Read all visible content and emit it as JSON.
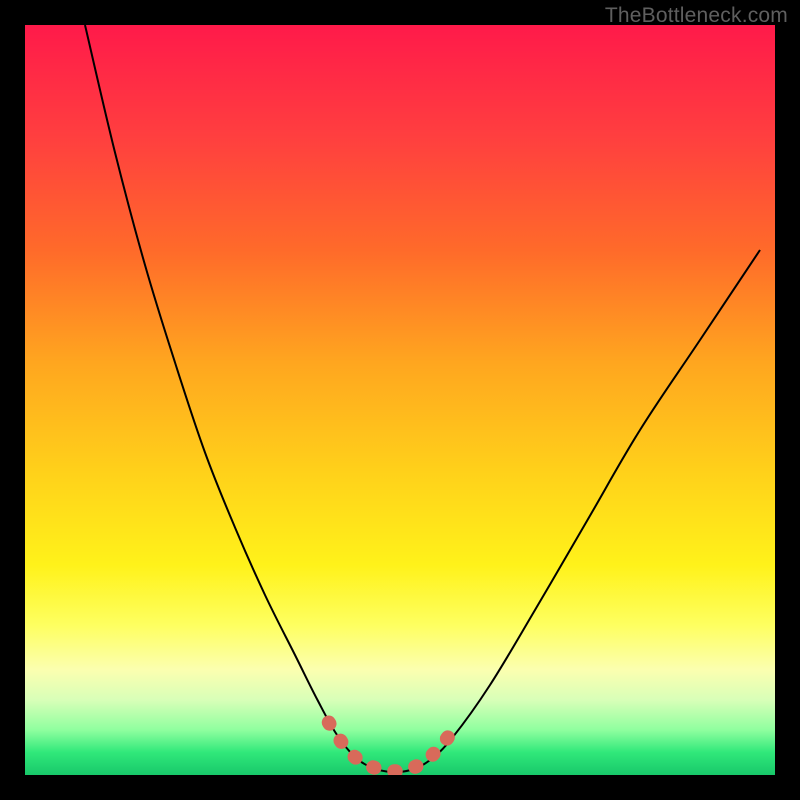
{
  "watermark": "TheBottleneck.com",
  "chart_data": {
    "type": "line",
    "title": "",
    "xlabel": "",
    "ylabel": "",
    "xlim": [
      0,
      100
    ],
    "ylim": [
      0,
      100
    ],
    "background": {
      "type": "vertical-gradient",
      "stops": [
        {
          "offset": 0.0,
          "color": "#ff1a4a"
        },
        {
          "offset": 0.15,
          "color": "#ff3f3f"
        },
        {
          "offset": 0.3,
          "color": "#ff6a2a"
        },
        {
          "offset": 0.45,
          "color": "#ffa61f"
        },
        {
          "offset": 0.6,
          "color": "#ffd21a"
        },
        {
          "offset": 0.72,
          "color": "#fff21a"
        },
        {
          "offset": 0.8,
          "color": "#feff60"
        },
        {
          "offset": 0.86,
          "color": "#fbffb0"
        },
        {
          "offset": 0.9,
          "color": "#d8ffb8"
        },
        {
          "offset": 0.94,
          "color": "#8fff9f"
        },
        {
          "offset": 0.97,
          "color": "#30e87a"
        },
        {
          "offset": 1.0,
          "color": "#18c86a"
        }
      ]
    },
    "series": [
      {
        "name": "bottleneck-curve",
        "stroke": "#000000",
        "stroke_width": 2,
        "points": [
          {
            "x": 8.0,
            "y": 100.0
          },
          {
            "x": 12.0,
            "y": 83.0
          },
          {
            "x": 16.0,
            "y": 68.0
          },
          {
            "x": 20.0,
            "y": 55.0
          },
          {
            "x": 24.0,
            "y": 43.0
          },
          {
            "x": 28.0,
            "y": 33.0
          },
          {
            "x": 32.0,
            "y": 24.0
          },
          {
            "x": 36.0,
            "y": 16.0
          },
          {
            "x": 39.0,
            "y": 10.0
          },
          {
            "x": 41.5,
            "y": 5.5
          },
          {
            "x": 44.0,
            "y": 2.4
          },
          {
            "x": 46.5,
            "y": 0.9
          },
          {
            "x": 49.0,
            "y": 0.4
          },
          {
            "x": 51.5,
            "y": 0.7
          },
          {
            "x": 54.0,
            "y": 2.0
          },
          {
            "x": 57.0,
            "y": 5.0
          },
          {
            "x": 62.0,
            "y": 12.0
          },
          {
            "x": 68.0,
            "y": 22.0
          },
          {
            "x": 75.0,
            "y": 34.0
          },
          {
            "x": 82.0,
            "y": 46.0
          },
          {
            "x": 90.0,
            "y": 58.0
          },
          {
            "x": 98.0,
            "y": 70.0
          }
        ]
      },
      {
        "name": "optimal-segment",
        "stroke": "#d86a5a",
        "stroke_width": 14,
        "stroke_dasharray": "1.5 20",
        "linecap": "round",
        "points": [
          {
            "x": 40.5,
            "y": 7.0
          },
          {
            "x": 42.5,
            "y": 4.0
          },
          {
            "x": 44.5,
            "y": 2.0
          },
          {
            "x": 46.8,
            "y": 0.9
          },
          {
            "x": 49.0,
            "y": 0.5
          },
          {
            "x": 51.2,
            "y": 0.8
          },
          {
            "x": 53.3,
            "y": 1.8
          },
          {
            "x": 55.2,
            "y": 3.6
          },
          {
            "x": 57.0,
            "y": 5.8
          }
        ]
      }
    ]
  }
}
